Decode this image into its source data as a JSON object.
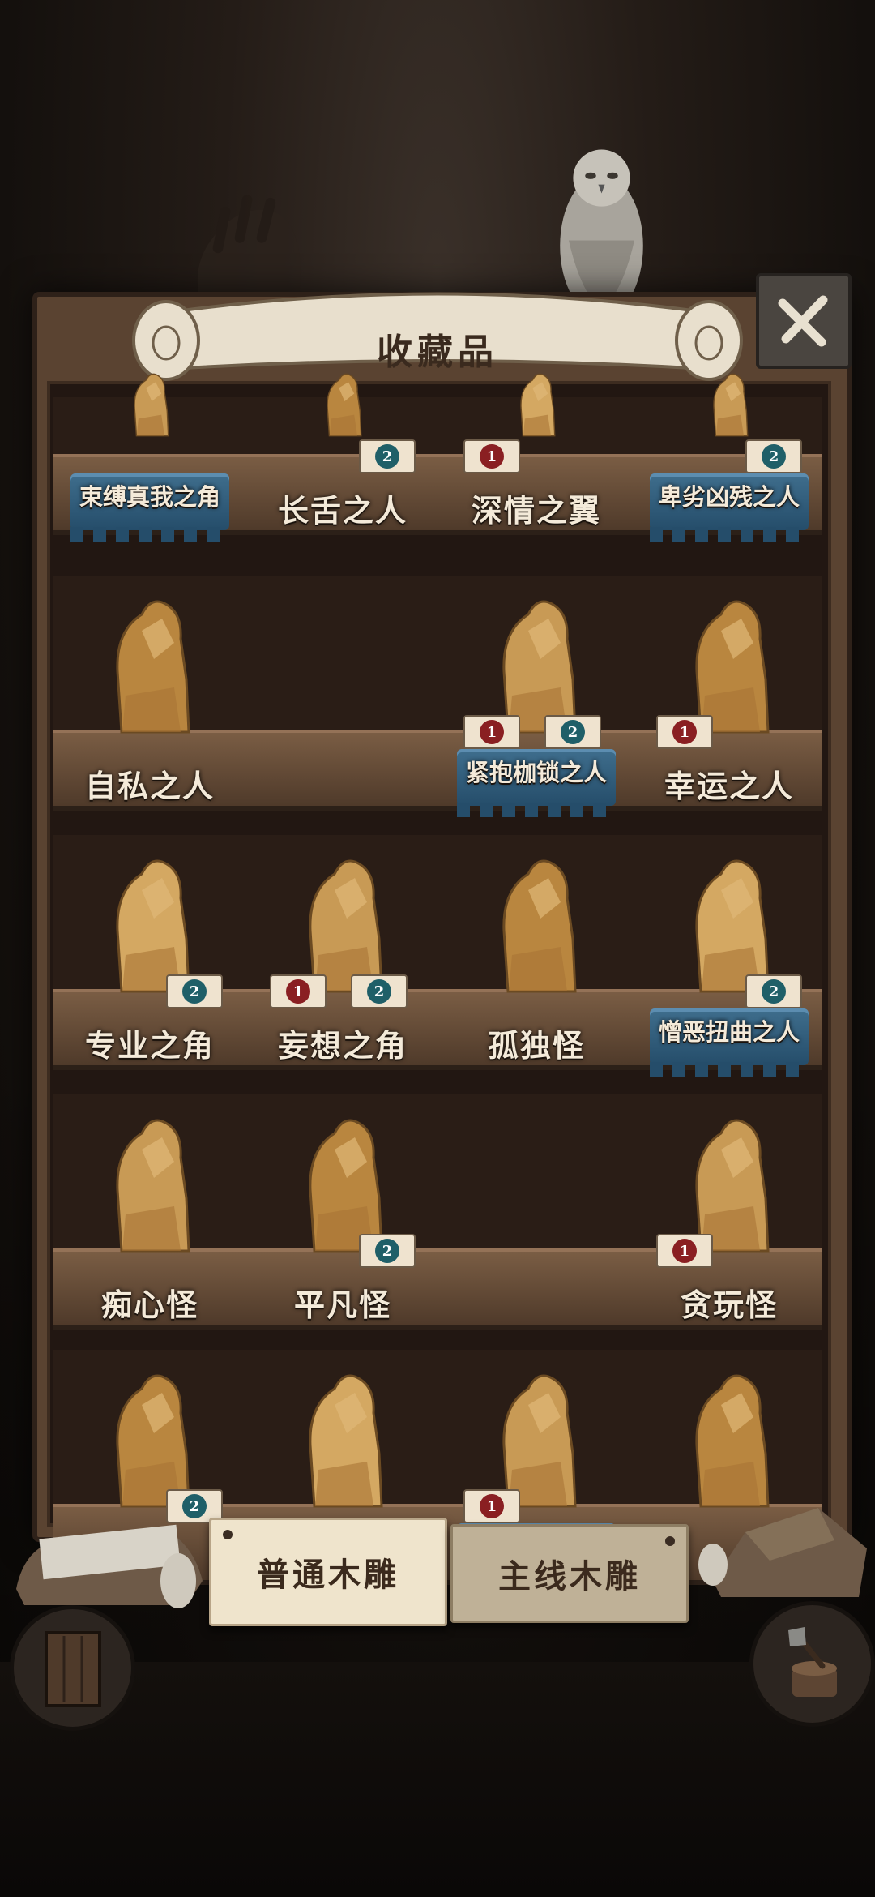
{
  "panel": {
    "title": "收藏品",
    "close_icon": "x-close-icon"
  },
  "shelves": [
    {
      "items": [
        {
          "label": "束缚真我之角",
          "small": true,
          "plinth": true,
          "badges": []
        },
        {
          "label": "长舌之人",
          "small": false,
          "plinth": false,
          "badges": [
            "2"
          ]
        },
        {
          "label": "深情之翼",
          "small": false,
          "plinth": false,
          "badges": [
            "1"
          ]
        },
        {
          "label": "卑劣凶残之人",
          "small": true,
          "plinth": true,
          "badges": [
            "2"
          ]
        }
      ]
    },
    {
      "items": [
        {
          "label": "自私之人",
          "small": false,
          "plinth": false,
          "badges": []
        },
        {
          "label": "",
          "small": false,
          "plinth": false,
          "badges": []
        },
        {
          "label": "紧抱枷锁之人",
          "small": true,
          "plinth": true,
          "badges": [
            "1",
            "2"
          ]
        },
        {
          "label": "幸运之人",
          "small": false,
          "plinth": false,
          "badges": [
            "1"
          ]
        }
      ]
    },
    {
      "items": [
        {
          "label": "专业之角",
          "small": false,
          "plinth": false,
          "badges": [
            "2"
          ]
        },
        {
          "label": "妄想之角",
          "small": false,
          "plinth": false,
          "badges": [
            "1",
            "2"
          ]
        },
        {
          "label": "孤独怪",
          "small": false,
          "plinth": false,
          "badges": []
        },
        {
          "label": "憎恶扭曲之人",
          "small": true,
          "plinth": true,
          "badges": [
            "2"
          ]
        }
      ]
    },
    {
      "items": [
        {
          "label": "痴心怪",
          "small": false,
          "plinth": false,
          "badges": []
        },
        {
          "label": "平凡怪",
          "small": false,
          "plinth": false,
          "badges": [
            "2"
          ]
        },
        {
          "label": "",
          "small": false,
          "plinth": false,
          "badges": []
        },
        {
          "label": "贪玩怪",
          "small": false,
          "plinth": false,
          "badges": [
            "1"
          ]
        }
      ]
    },
    {
      "items": [
        {
          "label": "",
          "small": false,
          "plinth": false,
          "badges": [
            "2"
          ]
        },
        {
          "label": "",
          "small": false,
          "plinth": false,
          "badges": []
        },
        {
          "label": "",
          "small": false,
          "plinth": true,
          "badges": [
            "1"
          ]
        },
        {
          "label": "",
          "small": false,
          "plinth": false,
          "badges": []
        }
      ]
    }
  ],
  "tabs": {
    "normal": "普通木雕",
    "main": "主线木雕"
  },
  "buttons": {
    "door_icon": "door-icon",
    "axe_icon": "axe-stump-icon"
  }
}
